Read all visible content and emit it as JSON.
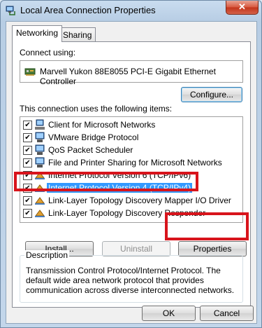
{
  "window": {
    "title": "Local Area Connection Properties",
    "close_glyph": "✕"
  },
  "tabs": [
    {
      "label": "Networking",
      "selected": true
    },
    {
      "label": "Sharing",
      "selected": false
    }
  ],
  "connect_using": {
    "label": "Connect using:",
    "adapter": "Marvell Yukon 88E8055 PCI-E Gigabit Ethernet Controller",
    "adapter_icon": "network-adapter-icon"
  },
  "buttons": {
    "configure": "Configure...",
    "install": "Install...",
    "uninstall": "Uninstall",
    "properties": "Properties",
    "ok": "OK",
    "cancel": "Cancel"
  },
  "items_label": "This connection uses the following items:",
  "items": [
    {
      "label": "Client for Microsoft Networks",
      "checked": true,
      "icon": "client-network-icon"
    },
    {
      "label": "VMware Bridge Protocol",
      "checked": true,
      "icon": "network-icon"
    },
    {
      "label": "QoS Packet Scheduler",
      "checked": true,
      "icon": "network-icon"
    },
    {
      "label": "File and Printer Sharing for Microsoft Networks",
      "checked": true,
      "icon": "network-icon"
    },
    {
      "label": "Internet Protocol Version 6 (TCP/IPv6)",
      "checked": true,
      "icon": "protocol-icon"
    },
    {
      "label": "Internet Protocol Version 4 (TCP/IPv4)",
      "checked": true,
      "icon": "protocol-icon",
      "selected": true
    },
    {
      "label": "Link-Layer Topology Discovery Mapper I/O Driver",
      "checked": true,
      "icon": "protocol-icon"
    },
    {
      "label": "Link-Layer Topology Discovery Responder",
      "checked": true,
      "icon": "protocol-icon"
    }
  ],
  "description": {
    "legend": "Description",
    "text": "Transmission Control Protocol/Internet Protocol. The default wide area network protocol that provides communication across diverse interconnected networks."
  },
  "colors": {
    "highlight_red": "#d8141c",
    "selection_blue": "#3399ff"
  }
}
